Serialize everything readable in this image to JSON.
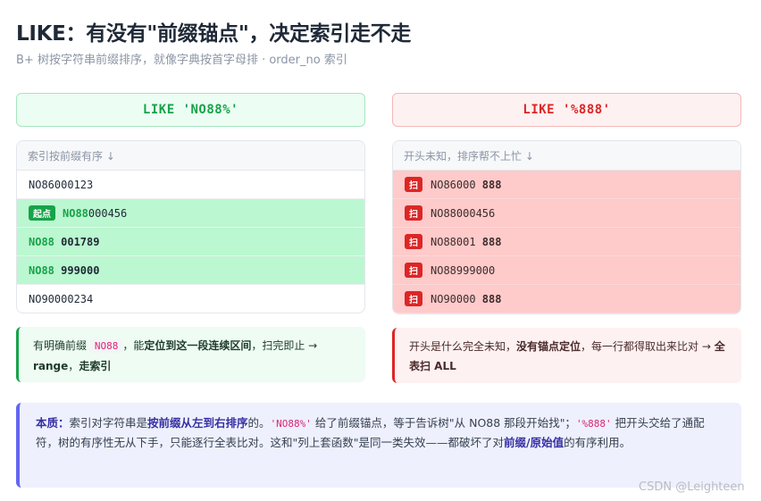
{
  "title": "LIKE：有没有\"前缀锚点\"，决定索引走不走",
  "subtitle": "B+ 树按字符串前缀排序，就像字典按首字母排 · order_no 索引",
  "left": {
    "pattern": "LIKE 'NO88%'",
    "header": "索引按前缀有序 ↓",
    "rows": [
      {
        "badge": "",
        "prefix": "",
        "plain": "NO86000123",
        "suffix": ""
      },
      {
        "badge": "起点",
        "prefix": "NO88",
        "plain": "",
        "suffix": "000456"
      },
      {
        "badge": "",
        "prefix": "NO88",
        "plain": "",
        "suffix": " 001789"
      },
      {
        "badge": "",
        "prefix": "NO88",
        "plain": "",
        "suffix": " 999000"
      },
      {
        "badge": "",
        "prefix": "",
        "plain": "NO90000234",
        "suffix": ""
      }
    ],
    "note": {
      "t1": "有明确前缀 ",
      "code": "NO88",
      "t2": "，能",
      "b1": "定位到这一段连续区间",
      "t3": "，扫完即止 → ",
      "b2": "range",
      "t4": "，",
      "b3": "走索引"
    }
  },
  "right": {
    "pattern": "LIKE '%888'",
    "header": "开头未知，排序帮不上忙 ↓",
    "badge": "扫",
    "rows": [
      {
        "plain": "NO86000 ",
        "bold": "888"
      },
      {
        "plain": "NO88000456",
        "bold": ""
      },
      {
        "plain": "NO88001 ",
        "bold": "888"
      },
      {
        "plain": "NO88999000",
        "bold": ""
      },
      {
        "plain": "NO90000 ",
        "bold": "888"
      }
    ],
    "note": {
      "t1": "开头是什么完全未知，",
      "b1": "没有锚点定位",
      "t2": "，每一行都得取出来比对 → ",
      "b2": "全表扫 ALL"
    }
  },
  "essence": {
    "k1": "本质：",
    "t1": "索引对字符串是",
    "k2": "按前缀从左到右排序",
    "t2": "的。",
    "c1": "'NO88%'",
    "t3": " 给了前缀锚点，等于告诉树\"从 NO88 那段开始找\"；",
    "c2": "'%888'",
    "t4": " 把开头交给了通配符，树的有序性无从下手，只能逐行全表比对。这和\"列上套函数\"是同一类失效——都破坏了对",
    "k3": "前缀/原始值",
    "t5": "的有序利用。"
  },
  "watermark": "CSDN @Leighteen"
}
